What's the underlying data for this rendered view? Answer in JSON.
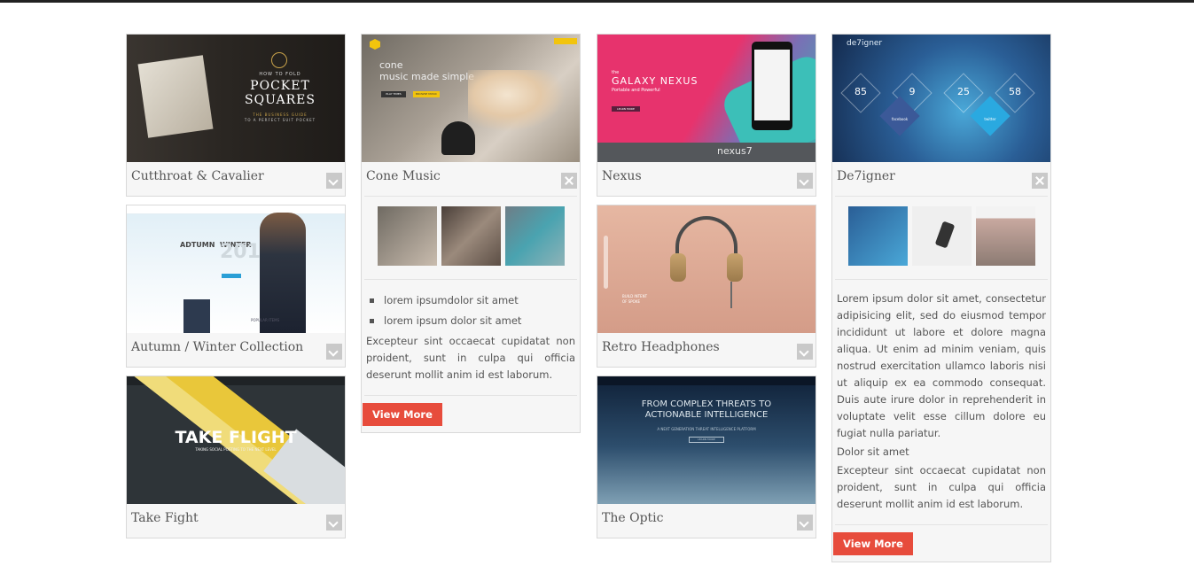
{
  "columns": [
    [
      {
        "title": "Cutthroat & Cavalier",
        "toggle": "expand",
        "thumb": {
          "lines": [
            "HOW TO FOLD",
            "POCKET",
            "SQUARES",
            "THE BUSINESS GUIDE",
            "TO A PERFECT SUIT POCKET"
          ]
        }
      },
      {
        "title": "Autumn / Winter Collection",
        "toggle": "expand",
        "thumb": {
          "lines": [
            "ADTUMN",
            "WINTER",
            "2014",
            "POPULAR ITEMS"
          ]
        }
      },
      {
        "title": "Take Fight",
        "toggle": "expand",
        "thumb": {
          "lines": [
            "TAKE FLIGHT",
            "TAKING SOCIAL POSTING TO THE NEXT LEVEL"
          ]
        }
      }
    ],
    [
      {
        "title": "Cone Music",
        "toggle": "close",
        "thumb": {
          "lines": [
            "cone",
            "music made simple",
            "PLAY TIMES",
            "BROWSE MUSIC"
          ]
        },
        "expanded": {
          "bullets": [
            "lorem ipsumdolor sit amet",
            "lorem ipsum dolor sit amet"
          ],
          "paragraphs": [
            "Excepteur sint occaecat cupidatat non proident, sunt in culpa qui officia deserunt mollit anim id est laborum."
          ],
          "button": "View More"
        }
      }
    ],
    [
      {
        "title": "Nexus",
        "toggle": "expand",
        "thumb": {
          "lines": [
            "the",
            "GALAXY NEXUS",
            "Portable and Powerful",
            "LEARN MORE",
            "nexus7"
          ]
        }
      },
      {
        "title": "Retro Headphones",
        "toggle": "expand",
        "thumb": {
          "lines": [
            "BUILD INTENT",
            "OF SPOKE"
          ]
        }
      },
      {
        "title": "The Optic",
        "toggle": "expand",
        "thumb": {
          "lines": [
            "FROM COMPLEX THREATS TO",
            "ACTIONABLE INTELLIGENCE",
            "A NEXT GENERATION THREAT INTELLIGENCE PLATFORM",
            "LEARN MORE"
          ]
        }
      }
    ],
    [
      {
        "title": "De7igner",
        "toggle": "close",
        "thumb": {
          "lines": [
            "de7igner",
            "85",
            "9",
            "25",
            "58",
            "facebook",
            "twitter"
          ]
        },
        "expanded": {
          "paragraphs": [
            "Lorem ipsum dolor sit amet, consectetur adipisicing elit, sed do eiusmod tempor incididunt ut labore et dolore magna aliqua. Ut enim ad minim veniam, quis nostrud exercitation ullamco laboris nisi ut aliquip ex ea commodo consequat. Duis aute irure dolor in reprehenderit in voluptate velit esse cillum dolore eu fugiat nulla pariatur.",
            "Dolor sit amet",
            "Excepteur sint occaecat cupidatat non proident, sunt in culpa qui officia deserunt mollit anim id est laborum."
          ],
          "button": "View More"
        }
      }
    ]
  ],
  "colors": {
    "accent": "#e74c3c",
    "card_bg": "#f6f6f6",
    "border": "#d9d9d9",
    "toggle": "#c9c9c9",
    "topbar": "#222222"
  }
}
